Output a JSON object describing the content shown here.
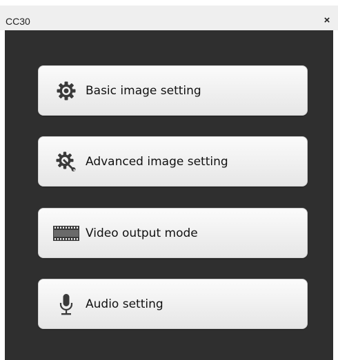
{
  "window": {
    "title": "CC30",
    "close_glyph": "×"
  },
  "menu": {
    "items": [
      {
        "label": "Basic image setting",
        "icon": "gear-icon"
      },
      {
        "label": "Advanced image setting",
        "icon": "gear-wrench-icon"
      },
      {
        "label": "Video output mode",
        "icon": "film-strip-icon"
      },
      {
        "label": "Audio setting",
        "icon": "microphone-icon"
      }
    ]
  },
  "colors": {
    "panel_background": "#2f2f2f",
    "titlebar_background": "#efefef",
    "button_gradient_top": "#fbfbfb",
    "button_gradient_bottom": "#e6e6e6",
    "icon_color": "#3a3a3a"
  }
}
